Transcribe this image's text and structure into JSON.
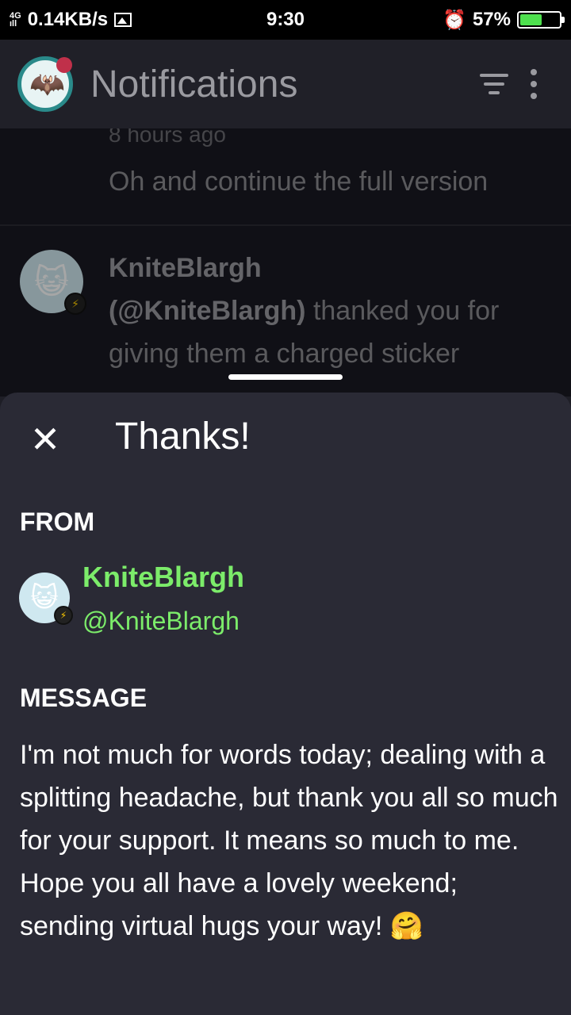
{
  "status_bar": {
    "network": "4G",
    "speed": "0.14KB/s",
    "time": "9:30",
    "battery": "57%",
    "battery_level": 0.57
  },
  "app_bar": {
    "title": "Notifications",
    "filter_icon": "filter-icon",
    "more_icon": "kebab-icon"
  },
  "background_notifications": [
    {
      "time": "8 hours ago",
      "text": "Oh and continue the full version"
    },
    {
      "user": "KniteBlargh",
      "handle": "(@KniteBlargh)",
      "action": "thanked you for giving them a charged sticker"
    }
  ],
  "sheet": {
    "close_icon": "close-icon",
    "title": "Thanks!",
    "from_label": "FROM",
    "from_name": "KniteBlargh",
    "from_handle": "@KniteBlargh",
    "message_label": "MESSAGE",
    "message": "I'm not much for words today; dealing with a splitting headache, but thank you all so much for your support. It means so much to me. Hope you all have a lovely weekend; sending virtual hugs your way! 🤗"
  },
  "colors": {
    "accent_green": "#7cec6a",
    "sheet_bg": "#2a2a35"
  }
}
